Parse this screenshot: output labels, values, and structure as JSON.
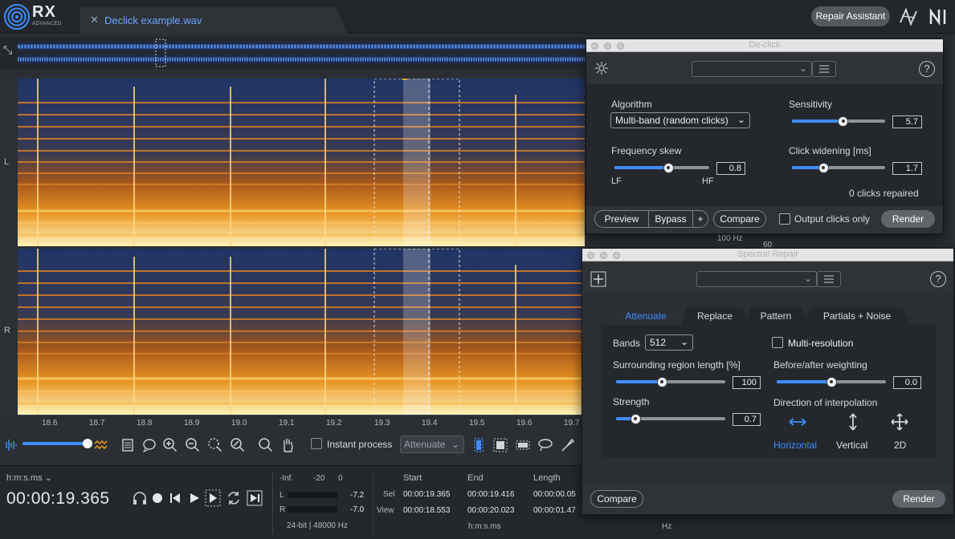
{
  "app": {
    "logo_text": "RX",
    "logo_sub": "ADVANCED",
    "file_tab": "Declick example.wav",
    "repair_assistant": "Repair Assistant"
  },
  "channels": {
    "left": "L",
    "right": "R"
  },
  "ruler": {
    "ticks": [
      "18.6",
      "18.7",
      "18.8",
      "18.9",
      "19.0",
      "19.1",
      "19.2",
      "19.3",
      "19.4",
      "19.5",
      "19.6",
      "19.7"
    ]
  },
  "overlap": {
    "hz_label": "100 Hz",
    "db_label": "60"
  },
  "toolbar": {
    "instant_process": "Instant process",
    "mode_value": "Attenuate"
  },
  "transport": {
    "time_format": "h:m:s.ms",
    "current_time": "00:00:19.365"
  },
  "meters": {
    "scale": [
      "-Inf.",
      "-20",
      "0"
    ],
    "left_label": "L",
    "right_label": "R",
    "left_peak": "-7.2",
    "right_peak": "-7.0",
    "format": "24-bit | 48000 Hz"
  },
  "selection": {
    "headers": [
      "Start",
      "End",
      "Length"
    ],
    "sel_label": "Sel",
    "view_label": "View",
    "sel": [
      "00:00:19.365",
      "00:00:19.416",
      "00:00:00.05"
    ],
    "view": [
      "00:00:18.553",
      "00:00:20.023",
      "00:00:01.47"
    ],
    "time_unit": "h:m:s.ms",
    "freq_unit": "Hz"
  },
  "declick": {
    "title": "De-click",
    "algorithm_label": "Algorithm",
    "algorithm_value": "Multi-band (random clicks)",
    "sensitivity_label": "Sensitivity",
    "sensitivity_value": "5.7",
    "sensitivity_level": 0.55,
    "freq_skew_label": "Frequency skew",
    "freq_skew_value": "0.8",
    "freq_skew_level": 0.57,
    "lf": "LF",
    "hf": "HF",
    "widening_label": "Click widening [ms]",
    "widening_value": "1.7",
    "widening_level": 0.34,
    "clicks_repaired": "0 clicks repaired",
    "preview": "Preview",
    "bypass": "Bypass",
    "plus": "+",
    "compare": "Compare",
    "output_clicks_only": "Output clicks only",
    "render": "Render"
  },
  "spectral": {
    "title": "Spectral Repair",
    "tabs": [
      "Attenuate",
      "Replace",
      "Pattern",
      "Partials + Noise"
    ],
    "bands_label": "Bands",
    "bands_value": "512",
    "multires_label": "Multi-resolution",
    "surround_label": "Surrounding region length [%]",
    "surround_value": "100",
    "surround_level": 0.42,
    "beforeafter_label": "Before/after weighting",
    "beforeafter_value": "0.0",
    "beforeafter_level": 0.5,
    "strength_label": "Strength",
    "strength_value": "0.7",
    "strength_level": 0.18,
    "interp_label": "Direction of interpolation",
    "interp_options": [
      "Horizontal",
      "Vertical",
      "2D"
    ],
    "compare": "Compare",
    "render": "Render"
  },
  "colors": {
    "accent": "#3f8cff",
    "panel": "#2f3338",
    "bg": "#2b2f34"
  }
}
